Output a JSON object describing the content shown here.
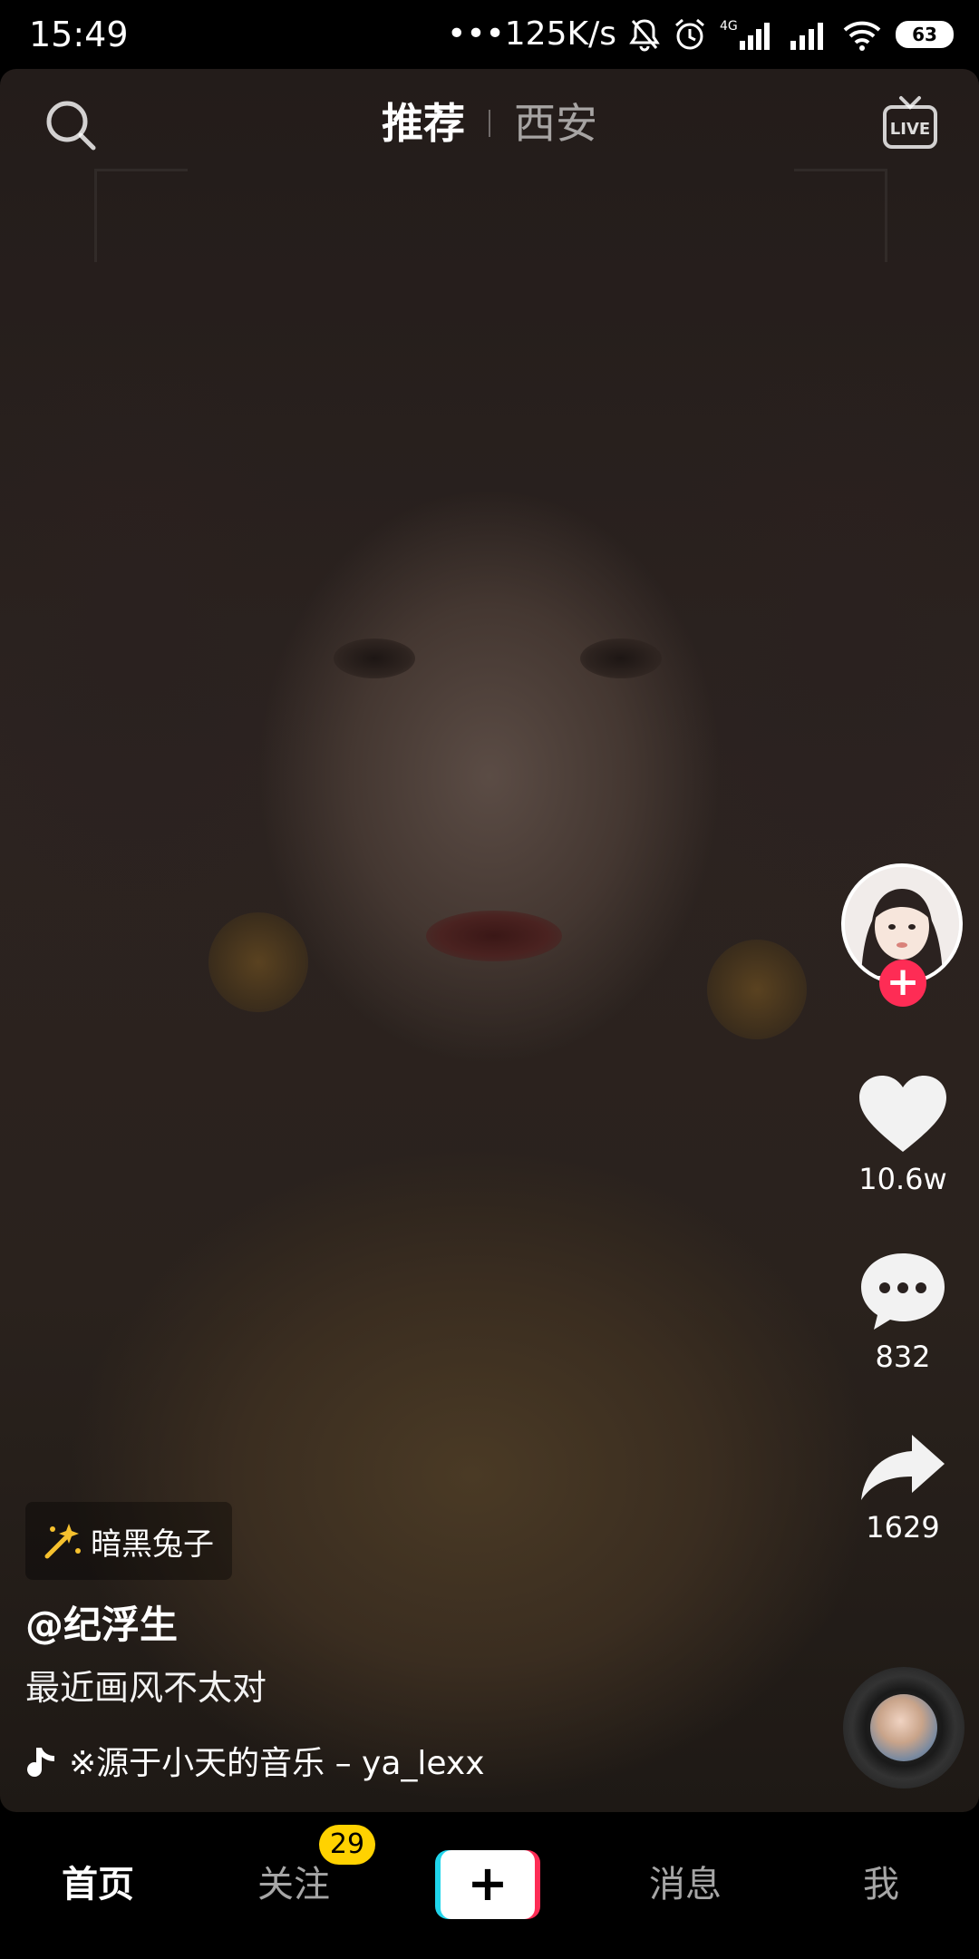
{
  "status_bar": {
    "time": "15:49",
    "network_speed": "•••125K/s",
    "network_type": "4G",
    "battery": "63"
  },
  "top_nav": {
    "tabs": [
      {
        "label": "推荐",
        "active": true
      },
      {
        "label": "西安",
        "active": false
      }
    ],
    "live_label": "LIVE"
  },
  "creator": {
    "follow_symbol": "+"
  },
  "actions": {
    "likes": "10.6w",
    "comments": "832",
    "shares": "1629"
  },
  "post": {
    "effect_name": "暗黑兔子",
    "author": "@纪浮生",
    "caption": "最近画风不太对",
    "music": "※源于小天的音乐 – ya_lexx"
  },
  "tab_bar": {
    "home": "首页",
    "following": "关注",
    "following_badge": "29",
    "create_symbol": "+",
    "messages": "消息",
    "me": "我"
  },
  "colors": {
    "accent_red": "#fe2c55",
    "accent_cyan": "#20d5ec",
    "badge_yellow": "#ffd200"
  }
}
